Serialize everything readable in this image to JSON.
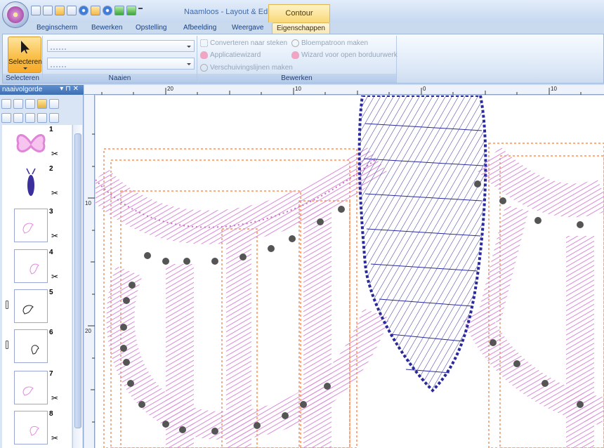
{
  "window": {
    "title": "Naamloos - Layout & Editing",
    "context_tab_title": "Contour"
  },
  "tabs": [
    {
      "label": "Beginscherm"
    },
    {
      "label": "Bewerken"
    },
    {
      "label": "Opstelling"
    },
    {
      "label": "Afbeelding"
    },
    {
      "label": "Weergave"
    },
    {
      "label": "Eigenschappen"
    }
  ],
  "ribbon": {
    "select_button_label": "Selecteren",
    "groups": {
      "selecteren": "Selecteren",
      "naaien": "Naaien",
      "bewerken": "Bewerken"
    },
    "commands": {
      "convert": "Converteren naar steken",
      "flower": "Bloempatroon maken",
      "applique": "Applicatiewizard",
      "openwork": "Wizard voor open borduurwerk",
      "shift_lines": "Verschuivingslijnen maken"
    }
  },
  "panel": {
    "title": "naaivolgorde",
    "items": [
      {
        "number": "1",
        "type": "butterfly-color"
      },
      {
        "number": "2",
        "type": "body"
      },
      {
        "number": "3",
        "type": "wing"
      },
      {
        "number": "4",
        "type": "wing"
      },
      {
        "number": "5",
        "type": "wing-outline"
      },
      {
        "number": "6",
        "type": "wing-outline"
      },
      {
        "number": "7",
        "type": "wing"
      },
      {
        "number": "8",
        "type": "wing"
      }
    ]
  },
  "rulers": {
    "top": [
      "20",
      "10",
      "0",
      "10"
    ],
    "left": [
      "10",
      "20"
    ]
  },
  "colors": {
    "stitch_pink": "#d67fd6",
    "stitch_blue": "#2e2fa0",
    "outline_orange": "#f08a5a",
    "dot_gray": "#555555",
    "accent": "#f9c04a"
  }
}
